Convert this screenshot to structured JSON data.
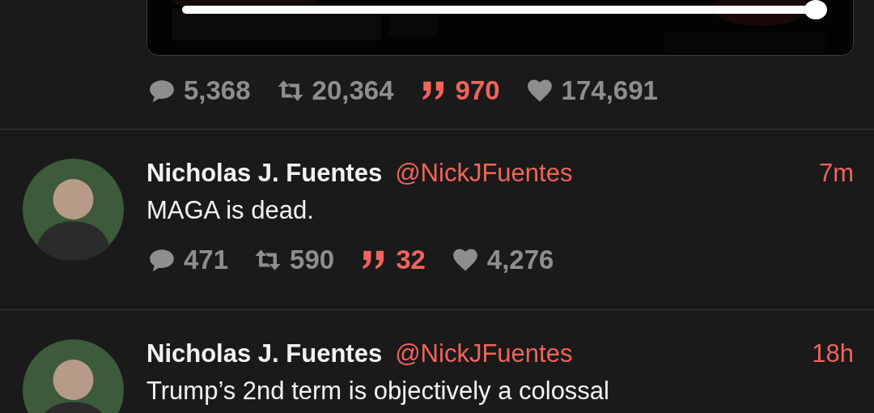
{
  "previous_post": {
    "media": {
      "kind": "picture",
      "progress": {
        "level": 0.98
      }
    },
    "stats": [
      {
        "kind": "replies",
        "count": "5,368",
        "active": false
      },
      {
        "kind": "reposts",
        "count": "20,364",
        "active": false
      },
      {
        "kind": "quotes",
        "count": "970",
        "active": true
      },
      {
        "kind": "likes",
        "count": "174,691",
        "active": false
      }
    ]
  },
  "posts": [
    {
      "name": "Nicholas J. Fuentes",
      "handle": "@NickJFuentes",
      "time": "7m",
      "text": "MAGA is dead.",
      "stats": [
        {
          "kind": "replies",
          "count": "471",
          "active": false
        },
        {
          "kind": "reposts",
          "count": "590",
          "active": false
        },
        {
          "kind": "quotes",
          "count": "32",
          "active": true
        },
        {
          "kind": "likes",
          "count": "4,276",
          "active": false
        }
      ]
    },
    {
      "name": "Nicholas J. Fuentes",
      "handle": "@NickJFuentes",
      "time": "18h",
      "text": "Trump’s 2nd term is objectively a colossal"
    }
  ]
}
